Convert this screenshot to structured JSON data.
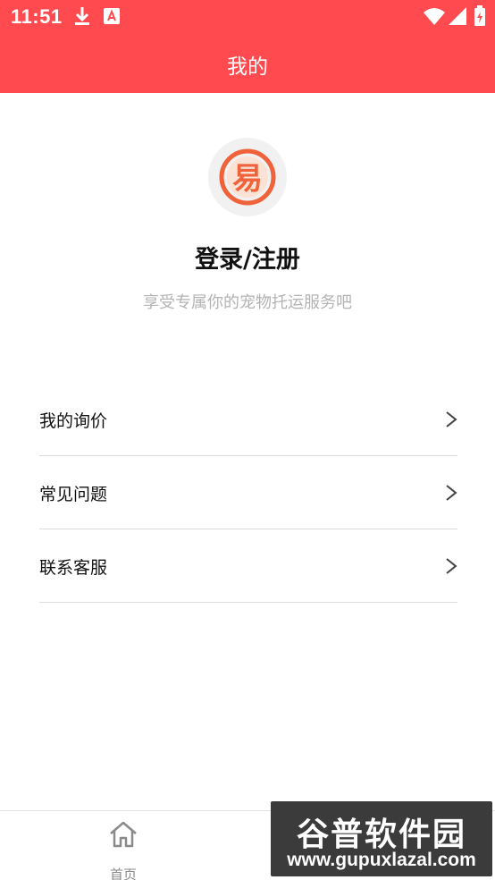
{
  "status_bar": {
    "time": "11:51",
    "icons": [
      "download-icon",
      "text-a-icon",
      "wifi-icon",
      "signal-icon",
      "battery-icon"
    ]
  },
  "header": {
    "title": "我的",
    "background_color": "#ff4b4f"
  },
  "profile": {
    "avatar_icon": "logo-yi-icon",
    "avatar_text": "易",
    "login_label": "登录/注册",
    "subtitle": "享受专属你的宠物托运服务吧"
  },
  "menu": [
    {
      "label": "我的询价"
    },
    {
      "label": "常见问题"
    },
    {
      "label": "联系客服"
    }
  ],
  "tabbar": {
    "items": [
      {
        "label": "首页",
        "icon": "home-icon"
      }
    ]
  },
  "watermark": {
    "title": "谷普软件园",
    "url": "www.gupuxlazal.com"
  }
}
